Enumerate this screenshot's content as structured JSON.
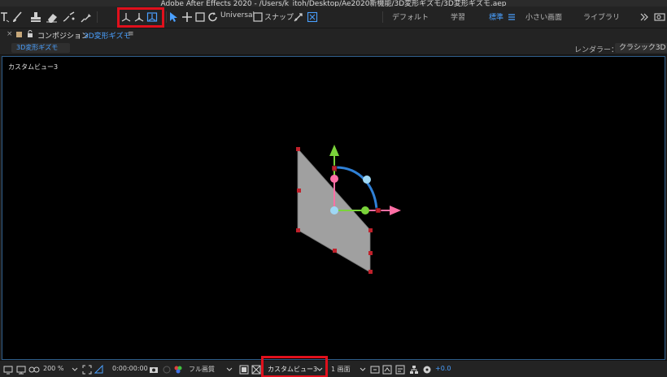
{
  "window": {
    "title": "Adobe After Effects 2020 - /Users/k_itoh/Desktop/Ae2020新機能/3D変形ギズモ/3D変形ギズモ.aep"
  },
  "toolbar": {
    "axis_mode_label": "Universal",
    "snap_label": "スナップ",
    "workspaces": [
      {
        "label": "デフォルト",
        "active": false
      },
      {
        "label": "学習",
        "active": false
      },
      {
        "label": "標準",
        "active": true
      },
      {
        "label": "小さい画面",
        "active": false
      },
      {
        "label": "ライブラリ",
        "active": false
      }
    ],
    "workspace_menu_icon": "hamburger-icon",
    "overflow_icon": "chevrons-right-icon"
  },
  "panel": {
    "close_glyph": "×",
    "lock_icon": "lock-icon",
    "panel_label": "コンポジション",
    "comp_name": "3D変形ギズモ",
    "menu_glyph": "≡",
    "tab_label": "3D変形ギズモ",
    "renderer_label": "レンダラー：",
    "renderer_value": "クラシック3D"
  },
  "viewer": {
    "view_name": "カスタムビュー3"
  },
  "bottom": {
    "zoom": "200 %",
    "timecode": "0:00:00:00",
    "resolution": "フル画質",
    "view_select": "カスタムビュー3",
    "view_layout": "1 画面",
    "exposure": "+0.0"
  },
  "colors": {
    "accent": "#4aa0ff",
    "highlight_box": "#e0101c",
    "y_axis": "#7ad33a",
    "x_axis": "#ff6fa5",
    "rotation_arc": "#2f80d6",
    "layer_fill": "#a0a0a0",
    "handle": "#c0212b"
  }
}
